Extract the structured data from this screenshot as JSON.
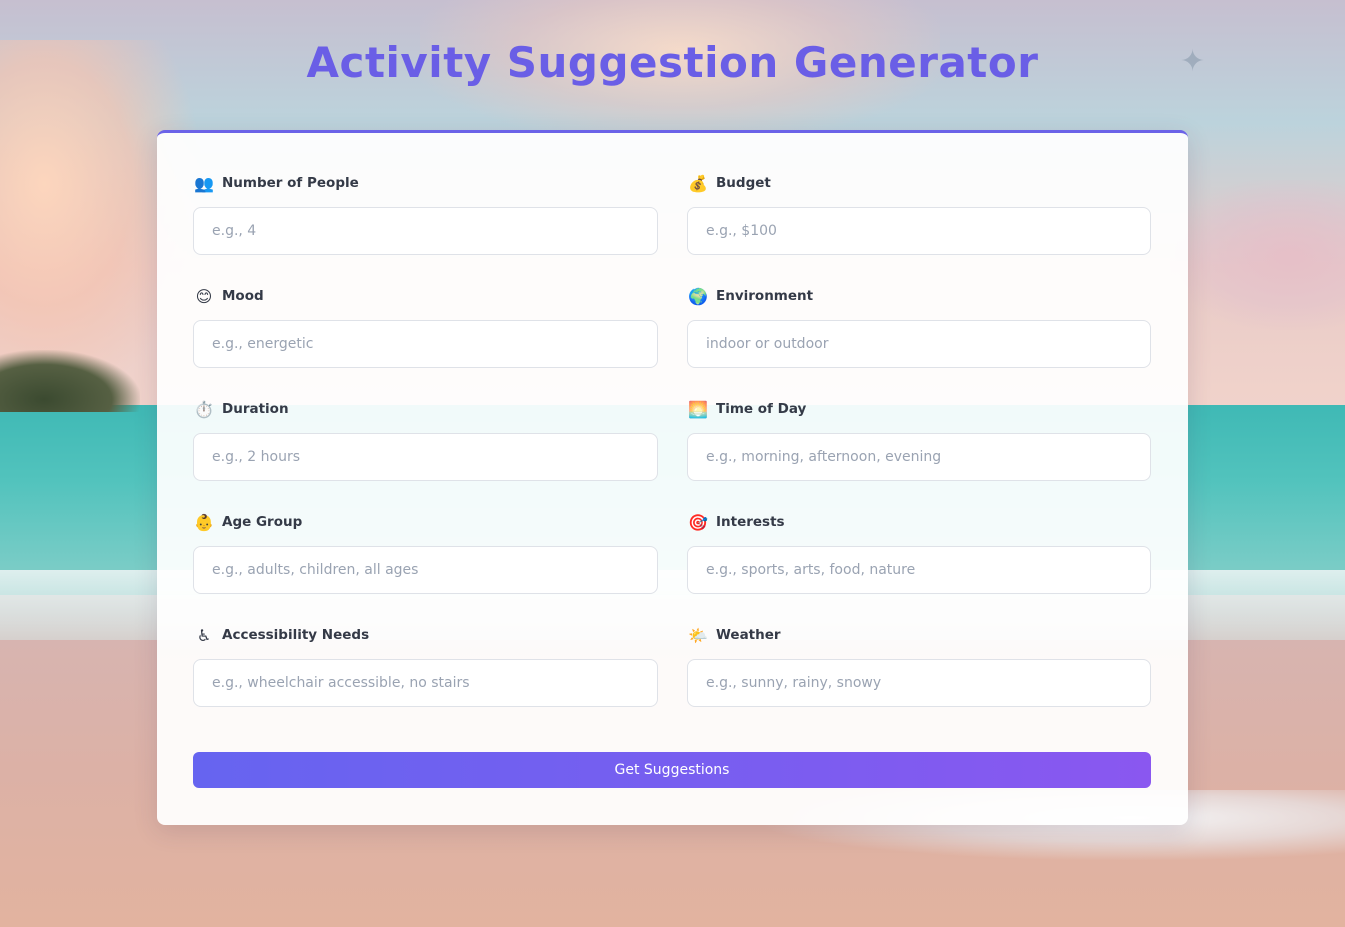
{
  "page": {
    "title": "Activity Suggestion Generator",
    "accent_color": "#6b63e8"
  },
  "form": {
    "fields": [
      {
        "icon": "👥",
        "icon_name": "people-icon",
        "label": "Number of People",
        "placeholder": "e.g., 4"
      },
      {
        "icon": "💰",
        "icon_name": "money-bag-icon",
        "label": "Budget",
        "placeholder": "e.g., $100"
      },
      {
        "icon": "😊",
        "icon_name": "smiley-icon",
        "label": "Mood",
        "placeholder": "e.g., energetic"
      },
      {
        "icon": "🌍",
        "icon_name": "globe-icon",
        "label": "Environment",
        "placeholder": "indoor or outdoor"
      },
      {
        "icon": "⏱️",
        "icon_name": "stopwatch-icon",
        "label": "Duration",
        "placeholder": "e.g., 2 hours"
      },
      {
        "icon": "🌅",
        "icon_name": "sunrise-icon",
        "label": "Time of Day",
        "placeholder": "e.g., morning, afternoon, evening"
      },
      {
        "icon": "👶",
        "icon_name": "baby-icon",
        "label": "Age Group",
        "placeholder": "e.g., adults, children, all ages"
      },
      {
        "icon": "🎯",
        "icon_name": "target-icon",
        "label": "Interests",
        "placeholder": "e.g., sports, arts, food, nature"
      },
      {
        "icon": "♿",
        "icon_name": "wheelchair-icon",
        "label": "Accessibility Needs",
        "placeholder": "e.g., wheelchair accessible, no stairs"
      },
      {
        "icon": "🌤️",
        "icon_name": "sun-cloud-icon",
        "label": "Weather",
        "placeholder": "e.g., sunny, rainy, snowy"
      }
    ],
    "submit_label": "Get Suggestions"
  }
}
